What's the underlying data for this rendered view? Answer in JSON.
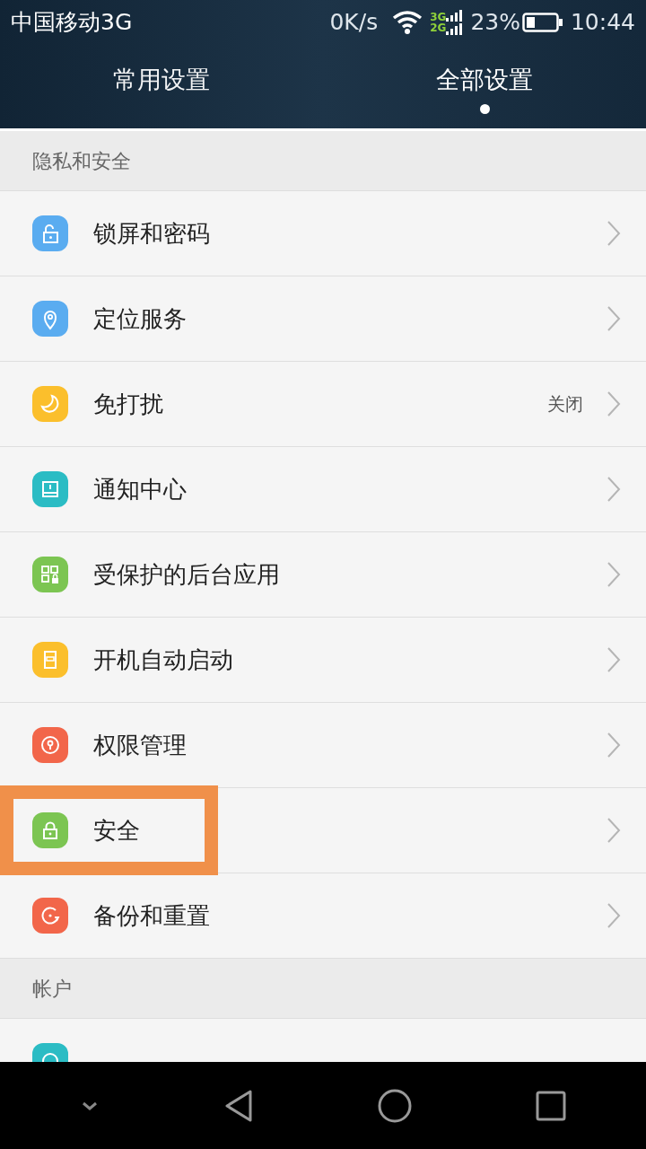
{
  "status_bar": {
    "carrier": "中国移动3G",
    "speed": "0K/s",
    "network_top": "3G",
    "network_bottom": "2G",
    "battery": "23%",
    "time": "10:44"
  },
  "tabs": [
    {
      "label": "常用设置",
      "selected": false
    },
    {
      "label": "全部设置",
      "selected": true
    }
  ],
  "sections": [
    {
      "title": "隐私和安全",
      "items": [
        {
          "label": "锁屏和密码",
          "kind": "lock-open",
          "color": "#5aacf0",
          "highlighted": false
        },
        {
          "label": "定位服务",
          "kind": "location",
          "color": "#5aacf0",
          "highlighted": false
        },
        {
          "label": "免打扰",
          "kind": "moon",
          "color": "#fbbf2c",
          "value": "关闭",
          "highlighted": false
        },
        {
          "label": "通知中心",
          "kind": "notice",
          "color": "#2bbcc4",
          "highlighted": false
        },
        {
          "label": "受保护的后台应用",
          "kind": "apps",
          "color": "#7cc552",
          "highlighted": false
        },
        {
          "label": "开机自动启动",
          "kind": "switch",
          "color": "#fbbf2c",
          "highlighted": false
        },
        {
          "label": "权限管理",
          "kind": "keyhole",
          "color": "#f2664a",
          "highlighted": false
        },
        {
          "label": "安全",
          "kind": "lock",
          "color": "#7cc552",
          "highlighted": true
        },
        {
          "label": "备份和重置",
          "kind": "backup",
          "color": "#f2664a",
          "highlighted": false
        }
      ]
    },
    {
      "title": "帐户",
      "items": [
        {
          "kind": "cloud",
          "color": "#2bbcc4",
          "highlighted": false
        }
      ]
    }
  ]
}
